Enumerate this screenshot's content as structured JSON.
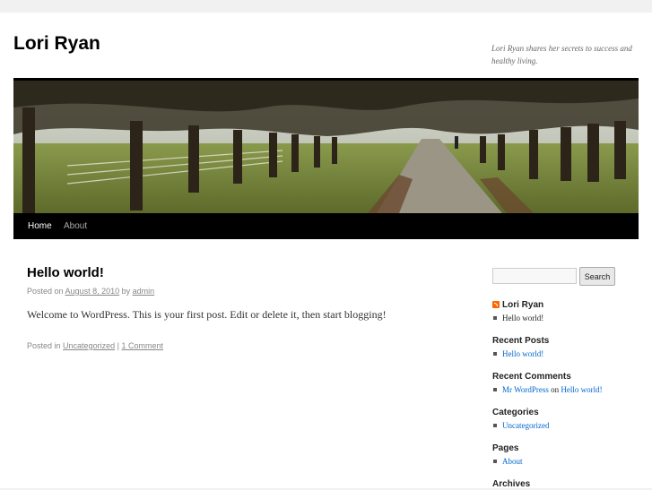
{
  "site": {
    "title": "Lori Ryan",
    "description": "Lori Ryan shares her secrets to success and healthy living."
  },
  "nav": {
    "items": [
      {
        "label": "Home",
        "current": true
      },
      {
        "label": "About",
        "current": false
      }
    ]
  },
  "post": {
    "title": "Hello world!",
    "posted_on": "Posted on",
    "date": "August 8, 2010",
    "by": "by",
    "author": "admin",
    "content": "Welcome to WordPress. This is your first post. Edit or delete it, then start blogging!",
    "posted_in": "Posted in",
    "category": "Uncategorized",
    "separator": "|",
    "comments": "1 Comment"
  },
  "sidebar": {
    "search": {
      "placeholder": "",
      "button": "Search"
    },
    "rss": {
      "title": "Lori Ryan",
      "items": [
        "Hello world!"
      ]
    },
    "recent_posts": {
      "title": "Recent Posts",
      "items": [
        "Hello world!"
      ]
    },
    "recent_comments": {
      "title": "Recent Comments",
      "author": "Mr WordPress",
      "on": "on",
      "post": "Hello world!"
    },
    "categories": {
      "title": "Categories",
      "items": [
        "Uncategorized"
      ]
    },
    "pages": {
      "title": "Pages",
      "items": [
        "About"
      ]
    },
    "archives": {
      "title": "Archives"
    }
  },
  "colors": {
    "link": "#0066cc",
    "rss": "#ff6600",
    "nav_bg": "#000000"
  }
}
